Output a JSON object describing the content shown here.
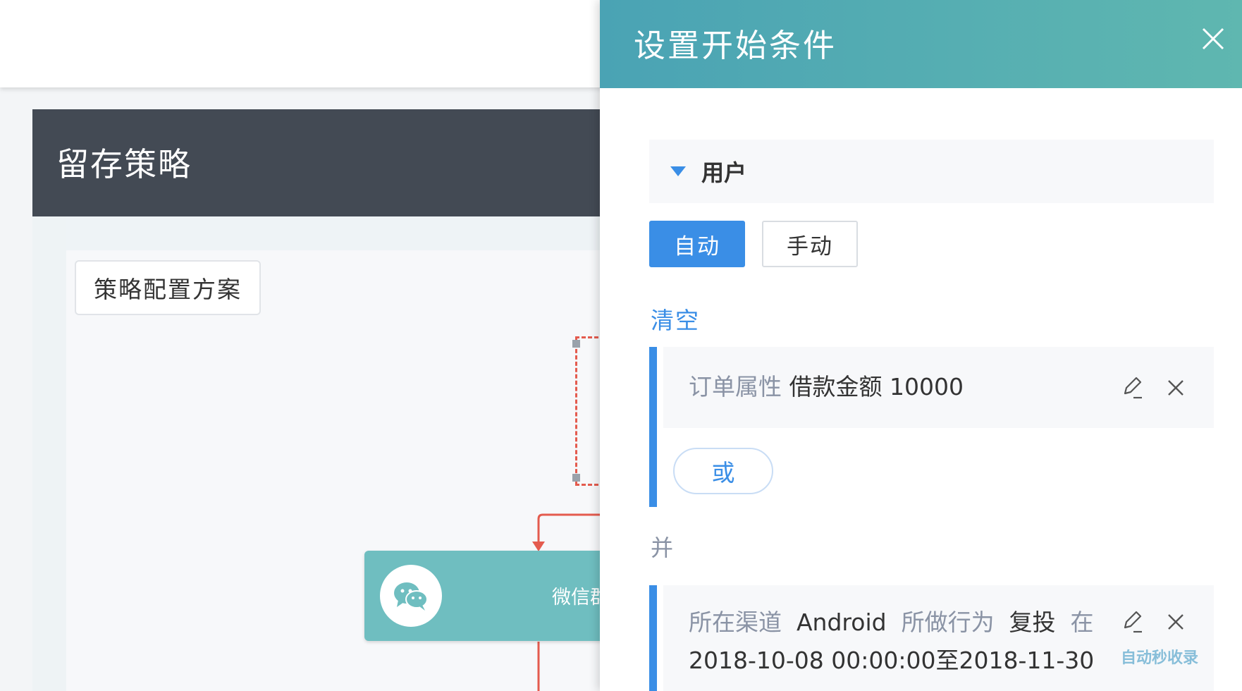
{
  "app": {
    "title": "留存策略",
    "scheme_button": "策略配置方案",
    "wechat_node_label": "微信群"
  },
  "drawer": {
    "title": "设置开始条件",
    "section_title": "用户",
    "modes": [
      "自动",
      "手动"
    ],
    "active_mode": "自动",
    "clear_label": "清空",
    "groups": [
      {
        "condition": {
          "field_label": "订单属性",
          "field_value": "借款金额",
          "value": "10000"
        },
        "or_label": "或"
      }
    ],
    "and_label": "并",
    "second_condition": {
      "channel_label": "所在渠道",
      "channel_value": "Android",
      "action_label": "所做行为",
      "action_value": "复投",
      "time_label": "在",
      "time_range": "2018-10-08 00:00:00至2018-11-30"
    }
  },
  "watermark": "自动秒收录",
  "colors": {
    "header_gradient_start": "#4aa3b4",
    "header_gradient_end": "#5fb7b0",
    "primary": "#3a8ee6",
    "app_header": "#434a54",
    "node": "#6fbec0",
    "flow_line": "#e45b4e"
  }
}
